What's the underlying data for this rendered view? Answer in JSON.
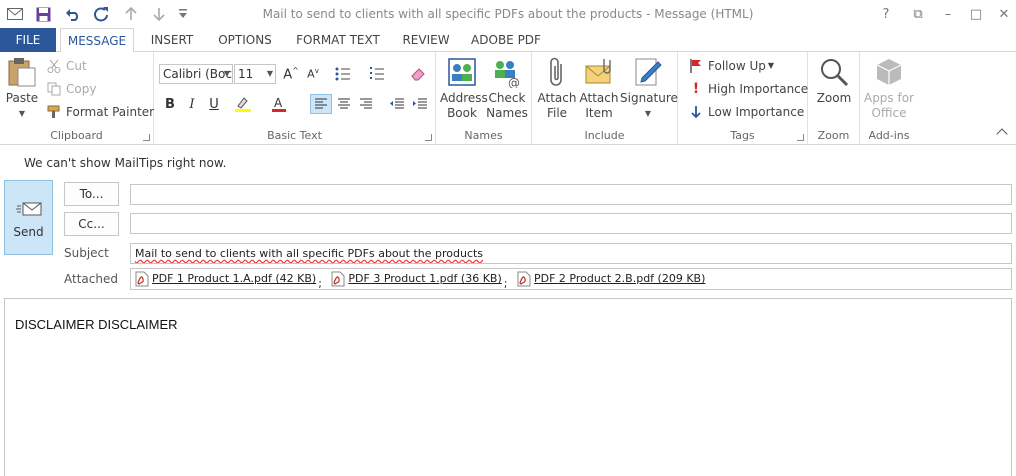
{
  "window": {
    "title": "Mail to send to clients with all specific PDFs about the products - Message (HTML)",
    "controls": [
      "?",
      "⧉",
      "–",
      "□",
      "✕"
    ]
  },
  "tabs": [
    "FILE",
    "MESSAGE",
    "INSERT",
    "OPTIONS",
    "FORMAT TEXT",
    "REVIEW",
    "ADOBE PDF"
  ],
  "active_tab": "MESSAGE",
  "ribbon": {
    "clipboard": {
      "label": "Clipboard",
      "paste": "Paste",
      "cut": "Cut",
      "copy": "Copy",
      "format_painter": "Format Painter"
    },
    "basic_text": {
      "label": "Basic Text",
      "font": "Calibri (Boc",
      "size": "11"
    },
    "names": {
      "label": "Names",
      "address_book": [
        "Address",
        "Book"
      ],
      "check_names": [
        "Check",
        "Names"
      ]
    },
    "include": {
      "label": "Include",
      "attach_file": [
        "Attach",
        "File"
      ],
      "attach_item": [
        "Attach",
        "Item"
      ],
      "signature": "Signature"
    },
    "tags": {
      "label": "Tags",
      "follow_up": "Follow Up",
      "high": "High Importance",
      "low": "Low Importance"
    },
    "zoom": {
      "label": "Zoom",
      "button": "Zoom"
    },
    "addins": {
      "label": "Add-ins",
      "apps": [
        "Apps for",
        "Office"
      ]
    }
  },
  "mail": {
    "mailtips": "We can't show MailTips right now.",
    "send": "Send",
    "to_label": "To...",
    "cc_label": "Cc...",
    "subject_label": "Subject",
    "subject_value": "Mail to send to clients with all specific PDFs about the products",
    "attached_label": "Attached",
    "attachments": [
      {
        "name": "PDF 1 Product 1.A.pdf (42 KB)"
      },
      {
        "name": "PDF 3 Product 1.pdf (36 KB)"
      },
      {
        "name": "PDF 2 Product 2.B.pdf (209 KB)"
      }
    ],
    "body": "DISCLAIMER DISCLAIMER"
  },
  "colors": {
    "accent": "#2b579a",
    "send_bg": "#cde6f7",
    "highlight": "#ffff00",
    "font_color": "#d22a2a",
    "high_importance": "#d22a2a",
    "low_importance": "#2b579a"
  }
}
